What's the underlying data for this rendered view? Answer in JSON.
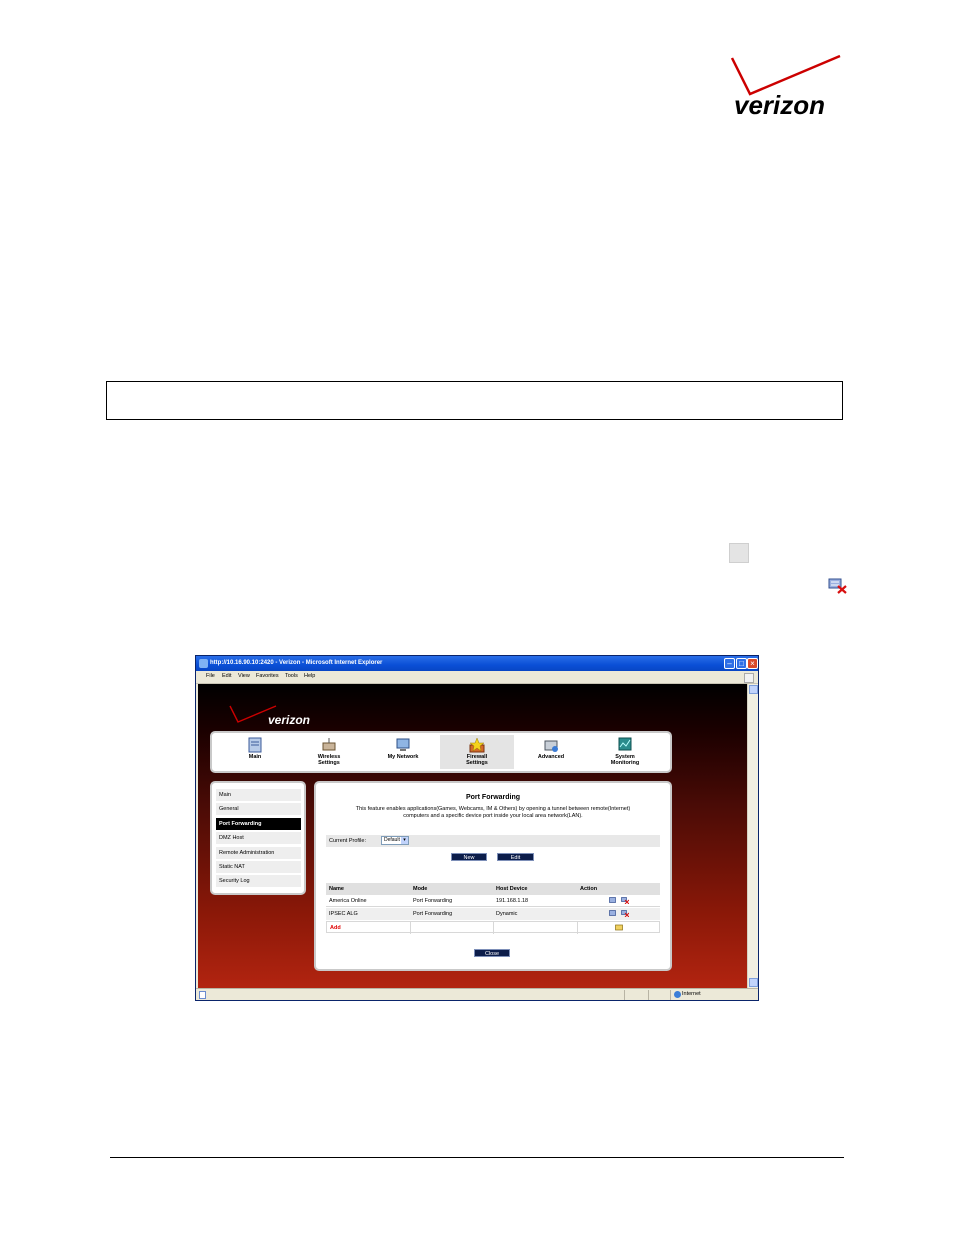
{
  "document": {
    "brand": "verizon"
  },
  "browser": {
    "title": "http://10.16.90.10:2420 - Verizon - Microsoft Internet Explorer",
    "menu": [
      "File",
      "Edit",
      "View",
      "Favorites",
      "Tools",
      "Help"
    ],
    "status_zone": "Internet"
  },
  "router": {
    "logo": "verizon",
    "nav": [
      {
        "label_line1": "Main",
        "label_line2": "",
        "icon": "main-icon"
      },
      {
        "label_line1": "Wireless",
        "label_line2": "Settings",
        "icon": "wireless-settings-icon"
      },
      {
        "label_line1": "My Network",
        "label_line2": "",
        "icon": "my-network-icon"
      },
      {
        "label_line1": "Firewall",
        "label_line2": "Settings",
        "icon": "firewall-settings-icon",
        "active": true
      },
      {
        "label_line1": "Advanced",
        "label_line2": "",
        "icon": "advanced-icon"
      },
      {
        "label_line1": "System",
        "label_line2": "Monitoring",
        "icon": "system-monitoring-icon"
      }
    ],
    "sidebar": [
      "Main",
      "General",
      "Port Forwarding",
      "DMZ Host",
      "Remote Administration",
      "Static NAT",
      "Security Log"
    ],
    "sidebar_active": "Port Forwarding",
    "panel": {
      "title": "Port Forwarding",
      "description_line1": "This feature enables applications(Games, Webcams, IM & Others) by opening a tunnel between remote(Internet)",
      "description_line2": "computers and a specific device port inside your local area network(LAN).",
      "profile_label": "Current Profile:",
      "profile_value": "Default",
      "new_button": "New",
      "edit_button": "Edit",
      "columns": [
        "Name",
        "Mode",
        "Host Device",
        "Action"
      ],
      "rows": [
        {
          "name": "America Online",
          "mode": "Port Forwarding",
          "host": "191.168.1.18"
        },
        {
          "name": "IPSEC ALG",
          "mode": "Port Forwarding",
          "host": "Dynamic"
        }
      ],
      "add_label": "Add",
      "close_button": "Close"
    }
  },
  "colors": {
    "brand_red": "#cc0000",
    "button_navy": "#0c1d4a",
    "active_sidebar": "#000000"
  }
}
